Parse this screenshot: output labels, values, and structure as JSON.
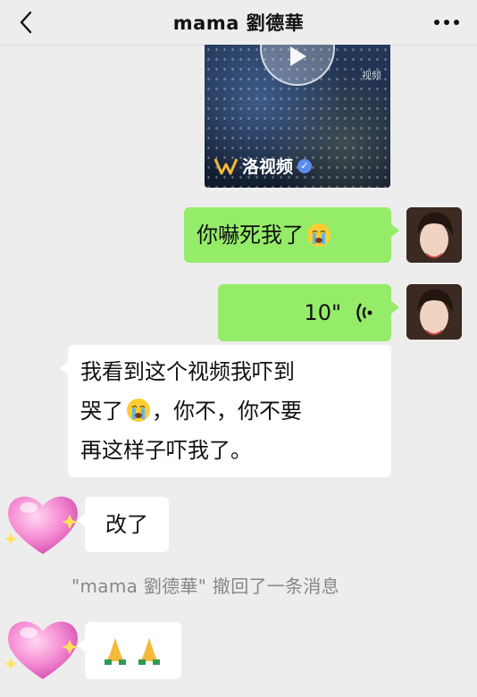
{
  "header": {
    "title": "mama 劉德華",
    "back_icon": "chevron-left-icon",
    "more_icon": "more-dots-icon"
  },
  "video": {
    "brand": "洛视频",
    "watermark": "视频"
  },
  "messages": [
    {
      "side": "right",
      "text": "你嚇死我了",
      "emoji": "crying-emoji"
    },
    {
      "side": "right",
      "type": "voice",
      "duration": "10\""
    },
    {
      "side": "left",
      "lines": [
        "我看到这个视频我吓到",
        "哭了",
        "，你不，你不要",
        "再这样子吓我了。"
      ],
      "emoji": "crying-emoji"
    },
    {
      "side": "left",
      "text": "改了"
    },
    {
      "side": "left",
      "text": "🙏🙏"
    }
  ],
  "recall_notice": "\"mama 劉德華\" 撤回了一条消息",
  "colors": {
    "bg": "#ededed",
    "green_bubble": "#95ec69",
    "white_bubble": "#ffffff",
    "notice": "#888888"
  }
}
